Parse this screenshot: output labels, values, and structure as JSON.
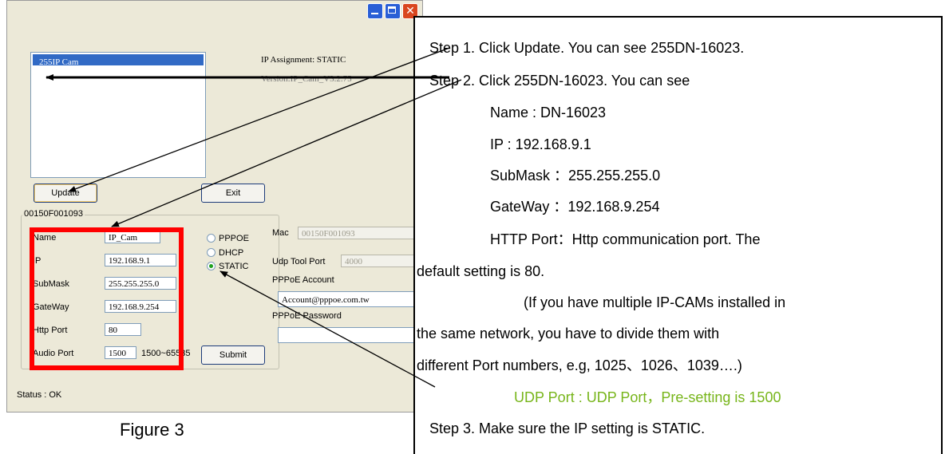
{
  "window": {
    "list_item": "255IP Cam",
    "ip_assignment": "IP Assignment: STATIC",
    "version": "Version:IP_Cam_V3.2.75",
    "update_label": "Update",
    "exit_label": "Exit",
    "group_label": "00150F001093",
    "fields": {
      "name_label": "Name",
      "name_value": "IP_Cam",
      "ip_label": "IP",
      "ip_value": "192.168.9.1",
      "submask_label": "SubMask",
      "submask_value": "255.255.255.0",
      "gateway_label": "GateWay",
      "gateway_value": "192.168.9.254",
      "http_label": "Http Port",
      "http_value": "80",
      "audio_label": "Audio Port",
      "audio_value": "1500",
      "audio_range": "1500~65535"
    },
    "radio": {
      "pppoe": "PPPOE",
      "dhcp": "DHCP",
      "static": "STATIC",
      "selected": "STATIC"
    },
    "mac_label": "Mac",
    "mac_value": "00150F001093",
    "udp_label": "Udp Tool Port",
    "udp_value": "4000",
    "pppoe_account_label": "PPPoE Account",
    "pppoe_account_value": "Account@pppoe.com.tw",
    "pppoe_password_label": "PPPoE Password",
    "pppoe_password_value": "",
    "submit_label": "Submit",
    "status": "Status :   OK"
  },
  "instructions": {
    "step1": "Step 1. Click Update. You can see 255DN-16023.",
    "step2": "Step 2. Click 255DN-16023. You can see",
    "name": "Name          : DN-16023",
    "ip": "IP              : 192.168.9.1",
    "submask": "SubMask ：255.255.255.0",
    "gateway": "GateWay ：192.168.9.254",
    "http1": "HTTP Port：Http communication port. The",
    "http2": "default setting is 80.",
    "note1": "(If you have multiple IP-CAMs installed in",
    "note2": "the same network, you have to divide them with",
    "note3": "different Port numbers, e.g, 1025、1026、1039….)",
    "udp": "UDP Port : UDP Port，Pre-setting is 1500",
    "step3": "Step 3. Make sure the IP setting is STATIC."
  },
  "caption": "Figure 3",
  "colors": {
    "highlight": "#ff0000",
    "udp_text": "#77b51a",
    "selection": "#316ac5"
  }
}
